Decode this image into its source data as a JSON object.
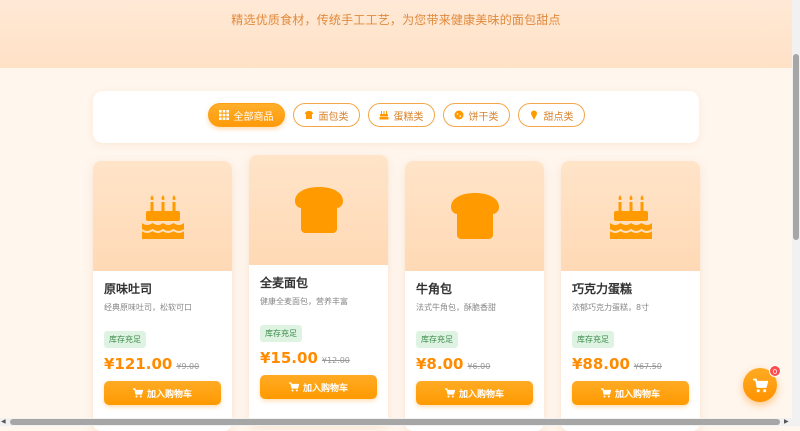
{
  "hero": {
    "tagline": "精选优质食材，传统手工工艺，为您带来健康美味的面包甜点"
  },
  "filters": [
    {
      "label": "全部商品",
      "icon": "grid-icon",
      "active": true
    },
    {
      "label": "面包类",
      "icon": "bread-icon",
      "active": false
    },
    {
      "label": "蛋糕类",
      "icon": "cake-icon",
      "active": false
    },
    {
      "label": "饼干类",
      "icon": "cookie-icon",
      "active": false
    },
    {
      "label": "甜点类",
      "icon": "ice-cream-icon",
      "active": false
    }
  ],
  "products": [
    {
      "name": "原味吐司",
      "desc": "经典原味吐司，松软可口",
      "stock": "库存充足",
      "price": "¥121.00",
      "original_price": "¥9.00",
      "icon": "cake-icon",
      "button": "加入购物车"
    },
    {
      "name": "全麦面包",
      "desc": "健康全麦面包，营养丰富",
      "stock": "库存充足",
      "price": "¥15.00",
      "original_price": "¥12.00",
      "icon": "bread-icon",
      "button": "加入购物车"
    },
    {
      "name": "牛角包",
      "desc": "法式牛角包，酥脆香甜",
      "stock": "库存充足",
      "price": "¥8.00",
      "original_price": "¥6.00",
      "icon": "bread-icon",
      "button": "加入购物车"
    },
    {
      "name": "巧克力蛋糕",
      "desc": "浓郁巧克力蛋糕，8寸",
      "stock": "库存充足",
      "price": "¥88.00",
      "original_price": "¥67.50",
      "icon": "cake-icon",
      "button": "加入购物车"
    }
  ],
  "cart": {
    "count": "0",
    "icon": "shopping-cart-icon"
  },
  "colors": {
    "accent": "#ff9a00",
    "accent_text": "#d9822b",
    "price": "#ff8c00"
  }
}
